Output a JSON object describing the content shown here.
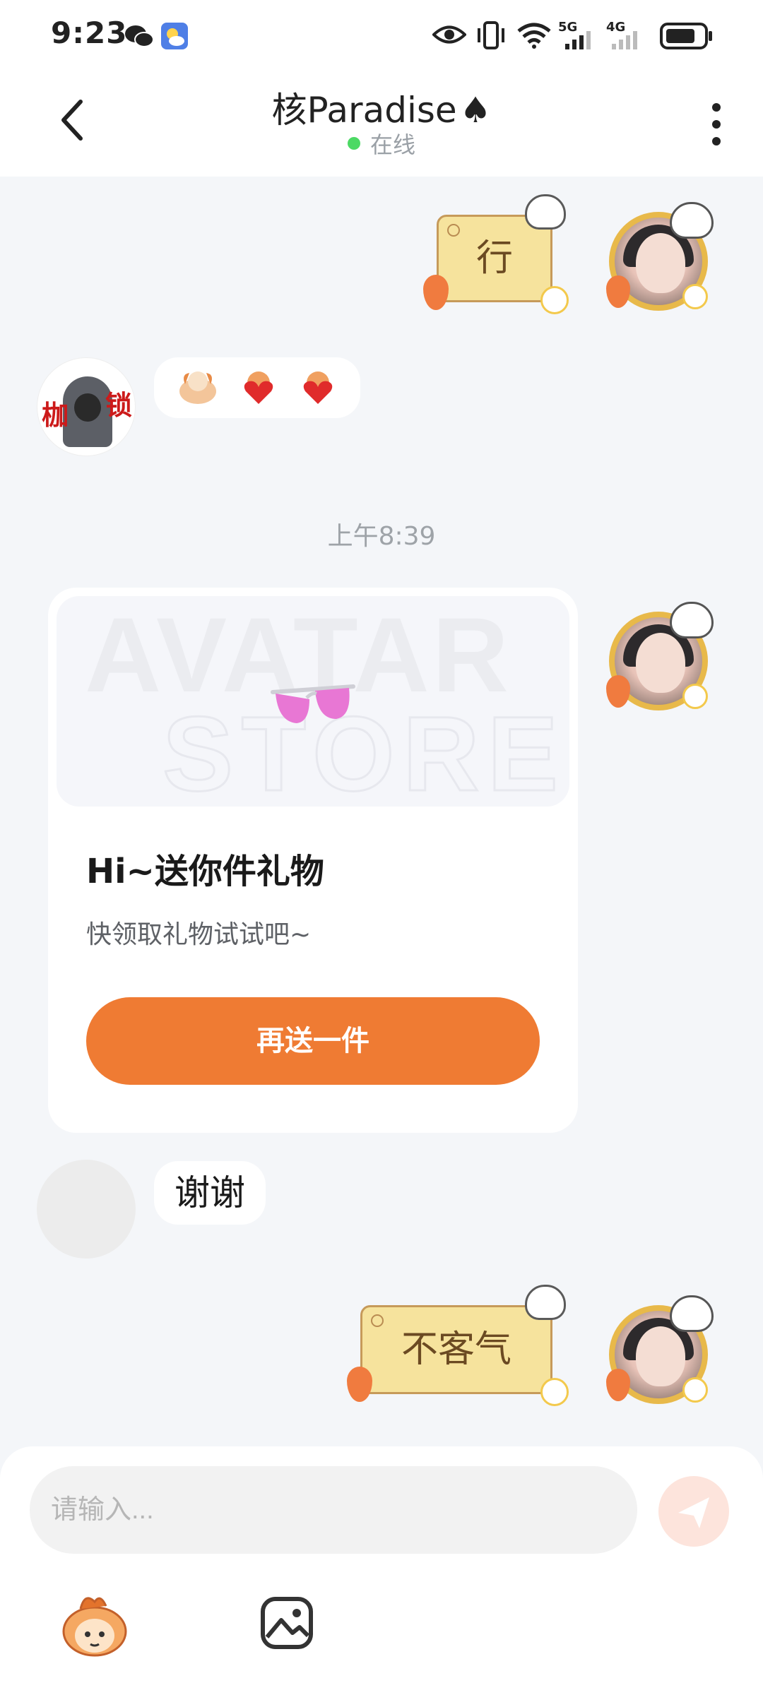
{
  "status_bar": {
    "time": "9:23",
    "net1": "5G",
    "net2": "4G"
  },
  "header": {
    "title": "核Paradise",
    "title_suffix": "♠",
    "status": "在线"
  },
  "messages": [
    {
      "side": "right",
      "type": "text",
      "text": "行"
    },
    {
      "side": "left",
      "type": "emoji"
    },
    {
      "type": "time",
      "text": "上午8:39"
    },
    {
      "side": "right",
      "type": "gift_card",
      "title": "Hi~送你件礼物",
      "subtitle": "快领取礼物试试吧~",
      "button_label": "再送一件"
    },
    {
      "side": "left",
      "type": "text",
      "text": "谢谢"
    },
    {
      "side": "right",
      "type": "text",
      "text": "不客气"
    }
  ],
  "input": {
    "placeholder": "请输入..."
  },
  "colors": {
    "accent": "#ef7b33",
    "online": "#4cd964",
    "bubble_yellow": "#f6e39d"
  }
}
